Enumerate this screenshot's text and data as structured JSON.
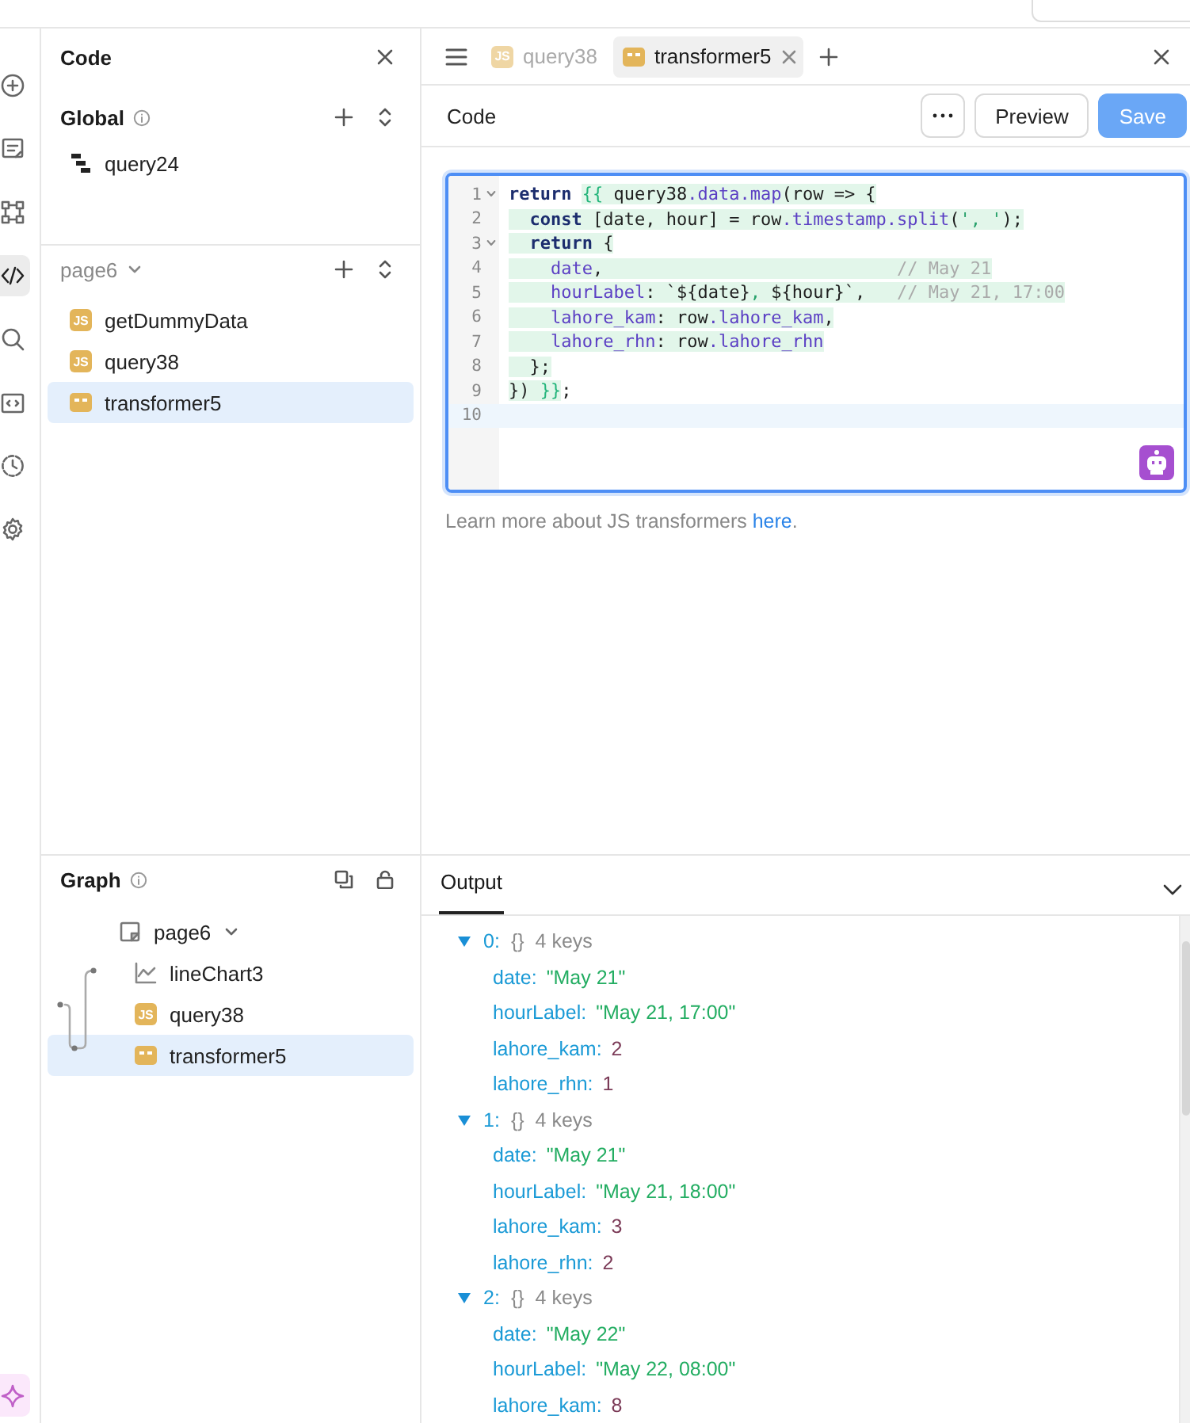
{
  "rail": {
    "items": [
      {
        "kind": "add",
        "selected": false
      },
      {
        "kind": "pages",
        "selected": false
      },
      {
        "kind": "nodes",
        "selected": false
      },
      {
        "kind": "code",
        "selected": true
      },
      {
        "kind": "search",
        "selected": false
      },
      {
        "kind": "embed",
        "selected": false
      },
      {
        "kind": "history",
        "selected": false
      },
      {
        "kind": "settings",
        "selected": false
      }
    ],
    "assistant": {
      "kind": "sparkle"
    }
  },
  "code_panel": {
    "title": "Code",
    "global": {
      "title": "Global",
      "items": [
        {
          "name": "query24",
          "kind": "workflow",
          "selected": false
        }
      ]
    },
    "page": {
      "title": "page6",
      "items": [
        {
          "name": "getDummyData",
          "kind": "js",
          "badge": "JS",
          "selected": false
        },
        {
          "name": "query38",
          "kind": "js",
          "badge": "JS",
          "selected": false
        },
        {
          "name": "transformer5",
          "kind": "transformer",
          "selected": true
        }
      ]
    }
  },
  "graph": {
    "title": "Graph",
    "root": {
      "name": "page6",
      "kind": "page",
      "expanded": true,
      "selected": false,
      "children": [
        {
          "name": "lineChart3",
          "kind": "chart",
          "selected": false
        },
        {
          "name": "query38",
          "kind": "js",
          "badge": "JS",
          "selected": false
        },
        {
          "name": "transformer5",
          "kind": "transformer",
          "selected": true
        }
      ]
    }
  },
  "tabs": [
    {
      "label": "query38",
      "kind": "js",
      "badge": "JS",
      "selected": false
    },
    {
      "label": "transformer5",
      "kind": "transformer",
      "selected": true
    }
  ],
  "editor": {
    "title": "Code",
    "buttons": [
      {
        "kind": "more",
        "disabled": false
      },
      {
        "kind": "secondary",
        "label": "Preview",
        "disabled": false
      },
      {
        "kind": "primary",
        "label": "Save",
        "disabled": true
      }
    ],
    "lines": [
      {
        "number": "1",
        "foldable": true,
        "active": false,
        "tokens": [
          {
            "text": "return ",
            "kind": "keyword",
            "highlighted": false
          },
          {
            "text": "{{",
            "kind": "mustache",
            "highlighted": true
          },
          {
            "text": " query38",
            "kind": "plain",
            "highlighted": true
          },
          {
            "text": ".data.map",
            "kind": "property",
            "highlighted": true
          },
          {
            "text": "(row => {",
            "kind": "plain",
            "highlighted": true
          }
        ]
      },
      {
        "number": "2",
        "foldable": false,
        "active": false,
        "tokens": [
          {
            "text": "  const",
            "kind": "keyword",
            "highlighted": true
          },
          {
            "text": " [date, hour] = row",
            "kind": "plain",
            "highlighted": true
          },
          {
            "text": ".timestamp.split",
            "kind": "property",
            "highlighted": true
          },
          {
            "text": "(",
            "kind": "plain",
            "highlighted": true
          },
          {
            "text": "', '",
            "kind": "string",
            "highlighted": true
          },
          {
            "text": ");",
            "kind": "plain",
            "highlighted": true
          }
        ]
      },
      {
        "number": "3",
        "foldable": true,
        "active": false,
        "tokens": [
          {
            "text": "  return",
            "kind": "keyword",
            "highlighted": true
          },
          {
            "text": " {",
            "kind": "plain",
            "highlighted": true
          }
        ]
      },
      {
        "number": "4",
        "foldable": false,
        "active": false,
        "tokens": [
          {
            "text": "    date",
            "kind": "property",
            "highlighted": true
          },
          {
            "text": ",                            ",
            "kind": "plain",
            "highlighted": true
          },
          {
            "text": "// May 21",
            "kind": "comment",
            "highlighted": true
          }
        ]
      },
      {
        "number": "5",
        "foldable": false,
        "active": false,
        "tokens": [
          {
            "text": "    hourLabel",
            "kind": "property",
            "highlighted": true
          },
          {
            "text": ": `${date}",
            "kind": "plain",
            "highlighted": true
          },
          {
            "text": ",",
            "kind": "string",
            "highlighted": true
          },
          {
            "text": " ${hour}`,   ",
            "kind": "plain",
            "highlighted": true
          },
          {
            "text": "// May 21, 17:00",
            "kind": "comment",
            "highlighted": true
          }
        ]
      },
      {
        "number": "6",
        "foldable": false,
        "active": false,
        "tokens": [
          {
            "text": "    lahore_kam",
            "kind": "property",
            "highlighted": true
          },
          {
            "text": ": row",
            "kind": "plain",
            "highlighted": true
          },
          {
            "text": ".lahore_kam",
            "kind": "property",
            "highlighted": true
          },
          {
            "text": ",",
            "kind": "plain",
            "highlighted": true
          }
        ]
      },
      {
        "number": "7",
        "foldable": false,
        "active": false,
        "tokens": [
          {
            "text": "    lahore_rhn",
            "kind": "property",
            "highlighted": true
          },
          {
            "text": ": row",
            "kind": "plain",
            "highlighted": true
          },
          {
            "text": ".lahore_rhn",
            "kind": "property",
            "highlighted": true
          }
        ]
      },
      {
        "number": "8",
        "foldable": false,
        "active": false,
        "tokens": [
          {
            "text": "  };",
            "kind": "plain",
            "highlighted": true
          }
        ]
      },
      {
        "number": "9",
        "foldable": false,
        "active": false,
        "tokens": [
          {
            "text": "}) ",
            "kind": "plain",
            "highlighted": true
          },
          {
            "text": "}}",
            "kind": "mustache",
            "highlighted": true
          },
          {
            "text": ";",
            "kind": "plain",
            "highlighted": false
          }
        ]
      },
      {
        "number": "10",
        "foldable": false,
        "active": true
      }
    ],
    "help": {
      "text": "Learn more about JS transformers ",
      "link": "here",
      "end": "."
    }
  },
  "output": {
    "tab": "Output",
    "items": [
      {
        "index": "0:",
        "type": "{}",
        "summary": "4 keys",
        "expanded": true,
        "fields": [
          {
            "key": "date:",
            "value": "\"May 21\"",
            "kind": "string"
          },
          {
            "key": "hourLabel:",
            "value": "\"May 21, 17:00\"",
            "kind": "string"
          },
          {
            "key": "lahore_kam:",
            "value": "2",
            "kind": "number"
          },
          {
            "key": "lahore_rhn:",
            "value": "1",
            "kind": "number"
          }
        ]
      },
      {
        "index": "1:",
        "type": "{}",
        "summary": "4 keys",
        "expanded": true,
        "fields": [
          {
            "key": "date:",
            "value": "\"May 21\"",
            "kind": "string"
          },
          {
            "key": "hourLabel:",
            "value": "\"May 21, 18:00\"",
            "kind": "string"
          },
          {
            "key": "lahore_kam:",
            "value": "3",
            "kind": "number"
          },
          {
            "key": "lahore_rhn:",
            "value": "2",
            "kind": "number"
          }
        ]
      },
      {
        "index": "2:",
        "type": "{}",
        "summary": "4 keys",
        "expanded": true,
        "fields": [
          {
            "key": "date:",
            "value": "\"May 22\"",
            "kind": "string"
          },
          {
            "key": "hourLabel:",
            "value": "\"May 22, 08:00\"",
            "kind": "string"
          },
          {
            "key": "lahore_kam:",
            "value": "8",
            "kind": "number"
          }
        ]
      }
    ]
  }
}
